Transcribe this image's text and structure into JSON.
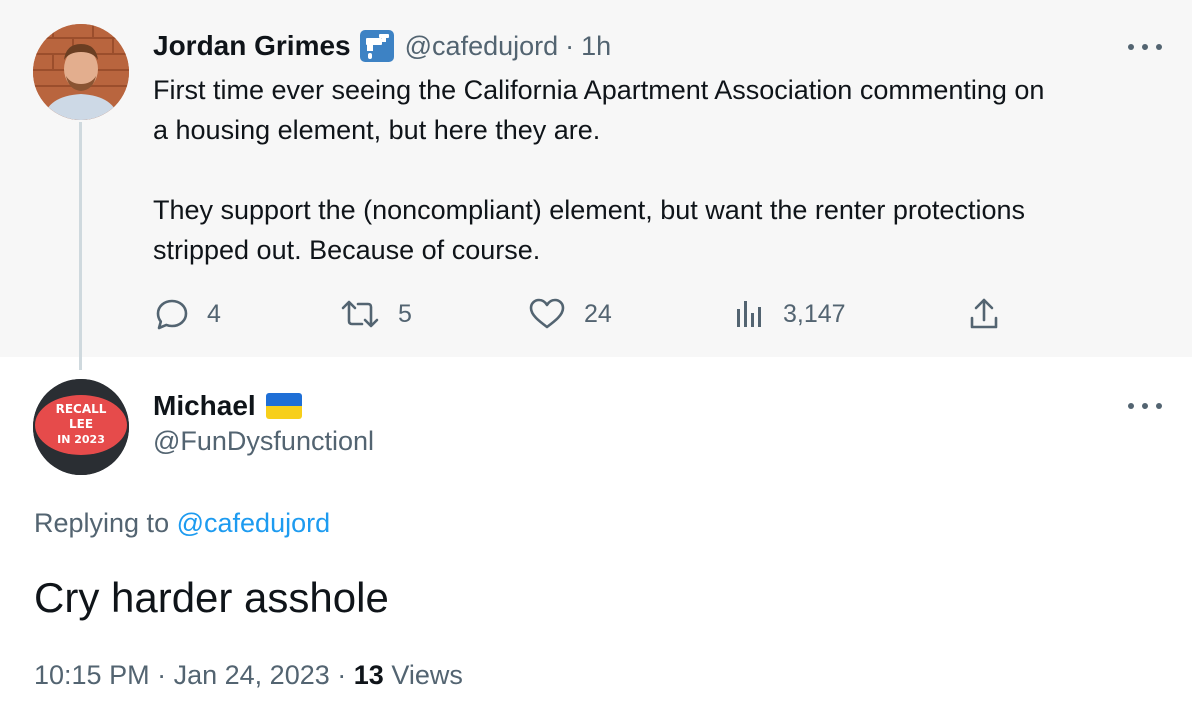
{
  "parent_tweet": {
    "author_name": "Jordan Grimes",
    "badge_icon": "water-faucet-icon",
    "handle": "@cafedujord",
    "separator": "·",
    "time": "1h",
    "lines": [
      "First time ever seeing the California Apartment Association commenting on",
      "a housing element, but here they are.",
      "They support the (noncompliant) element, but want the renter protections",
      "stripped out.  Because of course."
    ],
    "actions": {
      "reply_count": "4",
      "retweet_count": "5",
      "like_count": "24",
      "views_count": "3,147"
    }
  },
  "reply_tweet": {
    "author_name": "Michael",
    "flag": "ukraine-flag",
    "handle": "@FunDysfunctionl",
    "avatar_text": [
      "RECALL",
      "LEE",
      "IN 2023"
    ],
    "replying_prefix": "Replying to",
    "replying_to": "@cafedujord",
    "text": "Cry harder asshole",
    "time": "10:15 PM",
    "separator": "·",
    "date": "Jan 24, 2023",
    "views_count": "13",
    "views_label": "Views"
  },
  "colors": {
    "text_primary": "#0f1419",
    "text_secondary": "#536471",
    "link": "#1d9bf0",
    "parent_background": "#f7f7f7",
    "thread_line": "#cfd9de"
  }
}
